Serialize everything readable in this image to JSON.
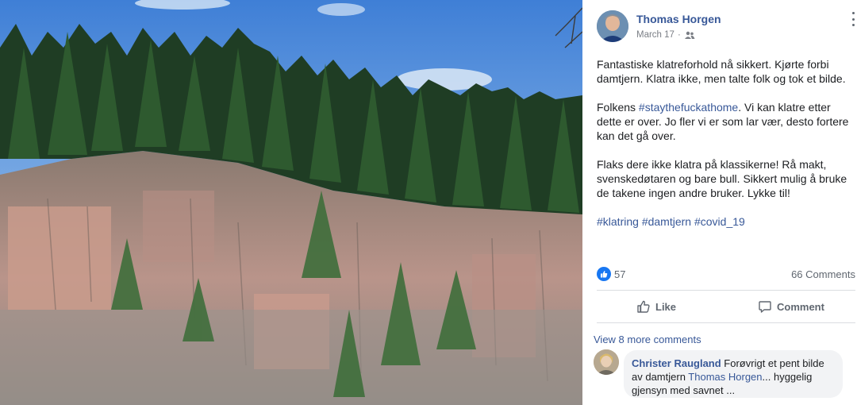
{
  "post": {
    "author": "Thomas Horgen",
    "date": "March 17",
    "separator": "·",
    "audience_icon": "friends-icon",
    "paragraphs": [
      {
        "text": "Fantastiske klatreforhold nå sikkert. Kjørte forbi damtjern. Klatra ikke, men talte folk og tok et bilde."
      },
      {
        "prefix": "Folkens ",
        "hashtag": "#staythefuckathome",
        "suffix": ". Vi kan klatre etter dette er over. Jo fler vi er som lar vær, desto fortere kan det gå over."
      },
      {
        "text": "Flaks dere ikke klatra på klassikerne! Rå makt, svenskedøtaren og bare bull. Sikkert mulig å bruke de takene ingen andre bruker. Lykke til!"
      }
    ],
    "hashtags": [
      "#klatring",
      "#damtjern",
      "#covid_19"
    ]
  },
  "stats": {
    "reaction_icon": "like-reaction-icon",
    "like_count": "57",
    "comments_count": "66 Comments"
  },
  "actions": {
    "like_label": "Like",
    "comment_label": "Comment"
  },
  "comments": {
    "view_more": "View 8 more comments",
    "items": [
      {
        "author": "Christer Raugland",
        "text_before": " Forøvrigt et pent bilde av damtjern ",
        "mention": "Thomas Horgen",
        "text_after": "... hyggelig gjensyn med savnet ..."
      }
    ]
  },
  "colors": {
    "link": "#385898",
    "like_blue": "#1877f2",
    "muted": "#606770",
    "bubble": "#f2f3f5"
  }
}
